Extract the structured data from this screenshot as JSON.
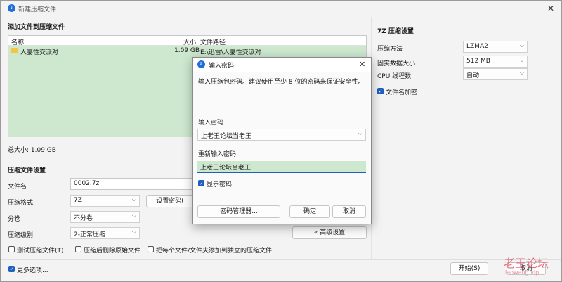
{
  "window": {
    "title": "新建压缩文件",
    "close_glyph": "✕"
  },
  "files": {
    "section_title": "添加文件到压缩文件",
    "columns": [
      "名称",
      "大小",
      "文件路径"
    ],
    "rows": [
      {
        "name": "人妻性交派对",
        "size": "1.09 GB",
        "path": "E:\\迅雷\\人妻性交派对"
      }
    ],
    "total_label": "总大小: 1.09 GB"
  },
  "settings": {
    "section_title": "压缩文件设置",
    "filename_label": "文件名",
    "filename_value": "0002.7z",
    "format_label": "压缩格式",
    "format_value": "7Z",
    "split_label": "分卷",
    "split_value": "不分卷",
    "level_label": "压缩级别",
    "level_value": "2-正常压缩",
    "set_password_button": "设置密码(",
    "advanced_button": "« 高级设置",
    "test_checkbox": "测试压缩文件(T)",
    "delete_checkbox": "压缩后删除原始文件",
    "separate_checkbox": "把每个文件/文件夹添加到独立的压缩文件"
  },
  "right_panel": {
    "title": "7Z 压缩设置",
    "method_label": "压缩方法",
    "method_value": "LZMA2",
    "solid_label": "固实数据大小",
    "solid_value": "512 MB",
    "threads_label": "CPU 线程数",
    "threads_value": "自动",
    "encrypt_names_label": "文件名加密"
  },
  "footer": {
    "more_options": "更多选项...",
    "start_button": "开始(S)",
    "cancel_button": "取消"
  },
  "dialog": {
    "title": "输入密码",
    "close_glyph": "✕",
    "description": "输入压缩包密码。建议使用至少 8 位的密码来保证安全性。",
    "password_label": "输入密码",
    "password_value": "上老王论坛当老王",
    "reenter_label": "重新输入密码",
    "reenter_value": "上老王论坛当老王",
    "show_password_label": "显示密码",
    "manager_button": "密码管理器...",
    "ok_button": "确定",
    "cancel_button": "取消"
  },
  "watermark": {
    "text": "老王论坛",
    "sub": "laowang.vip"
  },
  "colors": {
    "accent": "#1e5fbf",
    "selection": "#cde8cf",
    "watermark": "#e0596d"
  }
}
